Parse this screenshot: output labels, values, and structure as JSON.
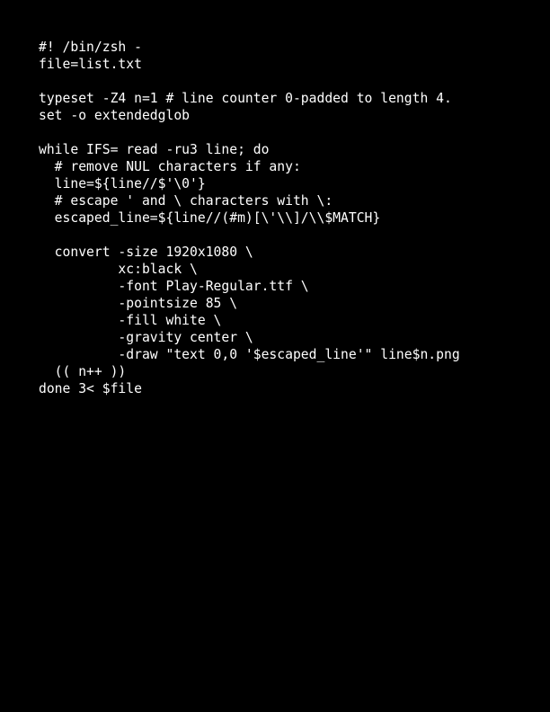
{
  "colors": {
    "background": "#000000",
    "text": "#ffffff"
  },
  "code": {
    "lines": [
      "#! /bin/zsh -",
      "file=list.txt",
      "",
      "typeset -Z4 n=1 # line counter 0-padded to length 4.",
      "set -o extendedglob",
      "",
      "while IFS= read -ru3 line; do",
      "  # remove NUL characters if any:",
      "  line=${line//$'\\0'}",
      "  # escape ' and \\ characters with \\:",
      "  escaped_line=${line//(#m)[\\'\\\\]/\\\\$MATCH}",
      "",
      "  convert -size 1920x1080 \\",
      "          xc:black \\",
      "          -font Play-Regular.ttf \\",
      "          -pointsize 85 \\",
      "          -fill white \\",
      "          -gravity center \\",
      "          -draw \"text 0,0 '$escaped_line'\" line$n.png",
      "  (( n++ ))",
      "done 3< $file"
    ]
  }
}
